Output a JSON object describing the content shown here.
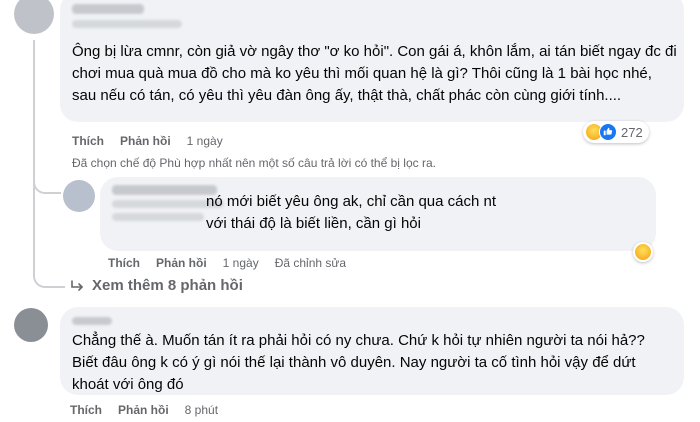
{
  "comment1": {
    "text": "Ông bị lừa cmnr, còn giả vờ ngây thơ \"ơ ko hỏi\". Con gái á, khôn lắm, ai tán biết ngay đc đi chơi mua quà mua đồ cho mà ko yêu thì mối quan hệ là gì? Thôi cũng là 1 bài học nhé, sau nếu có tán, có yêu thì yêu đàn ông ấy, thật thà, chất phác còn cùng giới tính....",
    "like_label": "Thích",
    "reply_label": "Phản hồi",
    "time": "1 ngày",
    "reaction_count": "272",
    "reaction_icons": [
      "haha-icon",
      "like-icon"
    ]
  },
  "filter_notice": "Đã chọn chế độ Phù hợp nhất nên một số câu trả lời có thể bị lọc ra.",
  "reply1": {
    "text": "nó mới biết yêu ông ak, chỉ cần qua cách nt với thái độ là biết liền, cần gì hỏi",
    "like_label": "Thích",
    "reply_label": "Phản hồi",
    "time": "1 ngày",
    "edited": "Đã chỉnh sửa",
    "reaction_icons": [
      "haha-icon"
    ]
  },
  "more_replies": "Xem thêm 8 phản hồi",
  "comment2": {
    "text": "Chẳng thế à. Muốn tán ít ra phải hỏi có ny chưa. Chứ k hỏi tự nhiên người ta nói hả?? Biết đâu ông k có ý gì nói thế lại thành vô duyên. Nay người ta cố tình hỏi vậy để dứt khoát với ông đó",
    "like_label": "Thích",
    "reply_label": "Phản hồi",
    "time": "8 phút"
  },
  "colors": {
    "bubble": "#f0f2f5",
    "secondary_text": "#65676b",
    "like_blue": "#1877f2",
    "haha_yellow": "#f7b125"
  }
}
